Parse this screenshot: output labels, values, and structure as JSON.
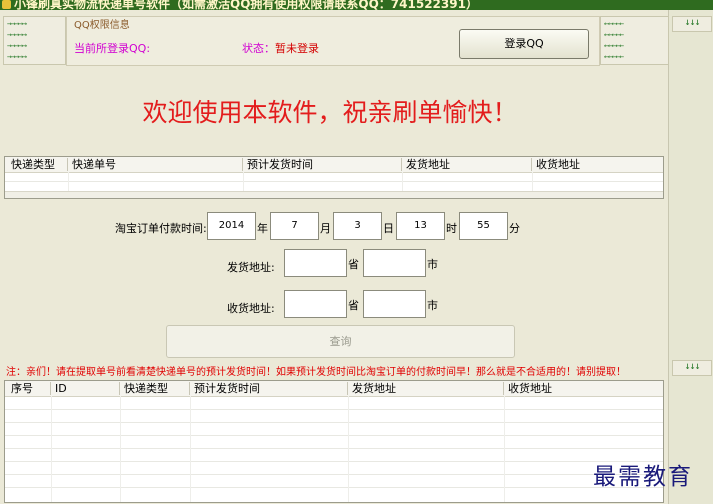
{
  "window": {
    "title": "小锋刷真实物流快递单号软件（如需激活QQ拥有使用权限请联系QQ：741522391）"
  },
  "arrows": {
    "right": "→→→→→",
    "left": "←←←←←",
    "down": "↓↓↓"
  },
  "qq_panel": {
    "label": "QQ权限信息",
    "current_user": "当前所登录QQ:",
    "status_label": "状态：",
    "status_value": "暂未登录",
    "login_button": "登录QQ"
  },
  "welcome": "欢迎使用本软件，祝亲刷单愉快！",
  "top_table": {
    "columns": [
      "快递类型",
      "快递单号",
      "预计发货时间",
      "发货地址",
      "收货地址"
    ]
  },
  "form": {
    "pay_time_label": "淘宝订单付款时间:",
    "year": "2014",
    "year_unit": "年",
    "month": "7",
    "month_unit": "月",
    "day": "3",
    "day_unit": "日",
    "hour": "13",
    "hour_unit": "时",
    "minute": "55",
    "minute_unit": "分",
    "ship_label": "发货地址:",
    "recv_label": "收货地址:",
    "province_unit": "省",
    "city_unit": "市",
    "query_button": "查询"
  },
  "note": "注：亲们！请在提取单号前看清楚快递单号的预计发货时间！如果预计发货时间比淘宝订单的付款时间早！那么就是不合适用的！请别提取！",
  "bottom_table": {
    "columns": [
      "序号",
      "ID",
      "快递类型",
      "预计发货时间",
      "发货地址",
      "收货地址"
    ]
  },
  "watermark": "最需教育"
}
